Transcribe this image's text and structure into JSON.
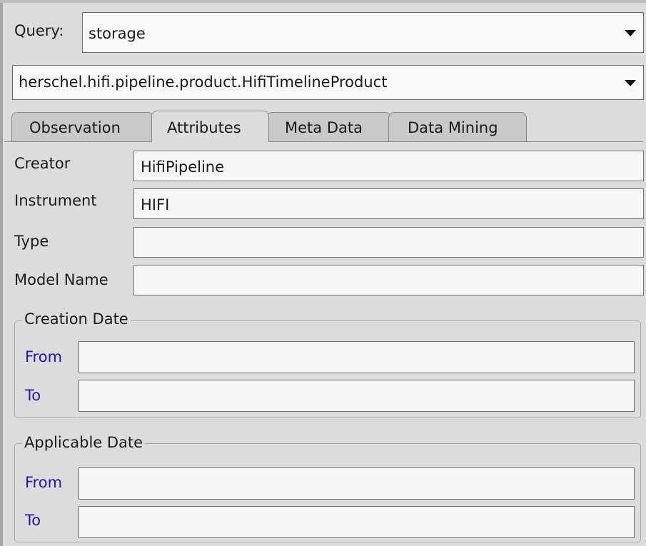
{
  "query": {
    "label": "Query:",
    "value": "storage"
  },
  "product_selector": {
    "value": "herschel.hifi.pipeline.product.HifiTimelineProduct"
  },
  "tabs": [
    {
      "label": "Observation"
    },
    {
      "label": "Attributes"
    },
    {
      "label": "Meta Data"
    },
    {
      "label": "Data Mining"
    }
  ],
  "fields": {
    "creator": {
      "label": "Creator",
      "value": "HifiPipeline"
    },
    "instrument": {
      "label": "Instrument",
      "value": "HIFI"
    },
    "type": {
      "label": "Type",
      "value": ""
    },
    "model_name": {
      "label": "Model Name",
      "value": ""
    }
  },
  "creation_date": {
    "title": "Creation Date",
    "from_label": "From",
    "to_label": "To",
    "from_value": "",
    "to_value": ""
  },
  "applicable_date": {
    "title": "Applicable Date",
    "from_label": "From",
    "to_label": "To",
    "from_value": "",
    "to_value": ""
  },
  "colors": {
    "panel": "#dcdcdc",
    "field": "#f7f7f7",
    "date_label": "#1c1ca8"
  }
}
